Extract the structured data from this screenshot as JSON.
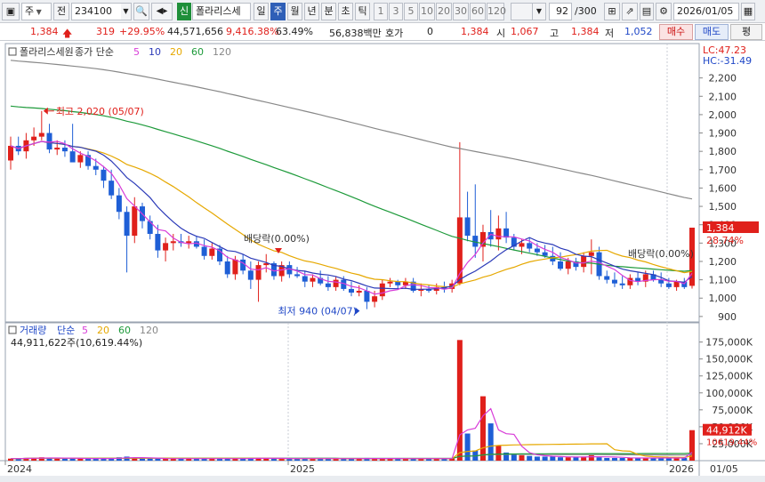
{
  "toolbar": {
    "type_select": "주",
    "prev_label": "전",
    "code": "234100",
    "tag": "신",
    "stock_name": "폴라리스세",
    "periods": [
      "일",
      "주",
      "월",
      "년",
      "분",
      "초",
      "틱"
    ],
    "period_selected": "주",
    "intervals": [
      "1",
      "3",
      "5",
      "10",
      "20",
      "30",
      "60",
      "120"
    ],
    "count": "92",
    "count_total": "/300",
    "date": "2026/01/05"
  },
  "quote": {
    "price": "1,384",
    "change": "319",
    "change_pct": "+29.95%",
    "volume": "44,571,656",
    "vol_ratio": "9,416.38%",
    "turnover": "63.49%",
    "amount": "56,838백만",
    "hoga_label": "호가",
    "hoga_value": "0",
    "ask_price": "1,384",
    "open_label": "시",
    "open": "1,067",
    "high_label": "고",
    "high": "1,384",
    "low_label": "저",
    "low": "1,052",
    "buy_label": "매수",
    "sell_label": "매도",
    "avg_label": "평"
  },
  "price_panel": {
    "legend_name": "폴라리스세원",
    "ma_label": "종가 단순",
    "ma_periods": [
      "5",
      "10",
      "20",
      "60",
      "120"
    ],
    "lc": "LC:47.23",
    "hc": "HC:-31.49",
    "y_ticks": [
      "2,200",
      "2,100",
      "2,000",
      "1,900",
      "1,800",
      "1,700",
      "1,600",
      "1,500",
      "1,400",
      "1,300",
      "1,200",
      "1,100",
      "1,000",
      "900"
    ],
    "current_tag": "1,384",
    "current_pct": "28.74%",
    "high_note": "최고 2,020 (05/07)",
    "low_note": "최저 940 (04/07)",
    "dividend_note": "배당락(0.00%)"
  },
  "volume_panel": {
    "legend_name": "거래량",
    "ma_label": "단순",
    "ma_periods": [
      "5",
      "20",
      "60",
      "120"
    ],
    "total": "44,911,622주(10,619.44%)",
    "y_ticks": [
      "175,000K",
      "150,000K",
      "125,000K",
      "100,000K",
      "75,000K",
      "50,000K",
      "25,000K"
    ],
    "current_tag": "44,912K",
    "current_pct": "10619.44%"
  },
  "x_axis": {
    "labels": [
      "2024",
      "2025",
      "2026",
      "01/05"
    ]
  },
  "colors": {
    "up": "#e0201b",
    "down": "#1f5fd6",
    "ma5": "#d83cd8",
    "ma10": "#2b3ab8",
    "ma20": "#e6a800",
    "ma60": "#1d9a3a",
    "ma120": "#888888"
  },
  "chart_data": {
    "type": "candlestick",
    "period": "weekly",
    "y_range": [
      880,
      2300
    ],
    "candles": [
      [
        1750,
        1880,
        1700,
        1830
      ],
      [
        1830,
        1880,
        1780,
        1800
      ],
      [
        1800,
        1900,
        1760,
        1860
      ],
      [
        1860,
        1930,
        1830,
        1880
      ],
      [
        1880,
        2020,
        1860,
        1900
      ],
      [
        1900,
        1950,
        1790,
        1810
      ],
      [
        1810,
        1860,
        1780,
        1820
      ],
      [
        1820,
        1860,
        1770,
        1800
      ],
      [
        1800,
        1950,
        1760,
        1740
      ],
      [
        1740,
        1800,
        1710,
        1780
      ],
      [
        1780,
        1800,
        1700,
        1720
      ],
      [
        1720,
        1760,
        1670,
        1700
      ],
      [
        1700,
        1720,
        1600,
        1640
      ],
      [
        1640,
        1700,
        1540,
        1560
      ],
      [
        1560,
        1600,
        1430,
        1470
      ],
      [
        1470,
        1500,
        1140,
        1340
      ],
      [
        1340,
        1550,
        1300,
        1500
      ],
      [
        1500,
        1520,
        1380,
        1420
      ],
      [
        1420,
        1450,
        1320,
        1350
      ],
      [
        1350,
        1400,
        1220,
        1260
      ],
      [
        1260,
        1330,
        1200,
        1300
      ],
      [
        1300,
        1350,
        1260,
        1310
      ],
      [
        1310,
        1350,
        1280,
        1300
      ],
      [
        1300,
        1340,
        1270,
        1310
      ],
      [
        1310,
        1340,
        1270,
        1280
      ],
      [
        1280,
        1320,
        1210,
        1230
      ],
      [
        1230,
        1300,
        1210,
        1270
      ],
      [
        1270,
        1290,
        1180,
        1200
      ],
      [
        1200,
        1230,
        1110,
        1130
      ],
      [
        1130,
        1230,
        1100,
        1210
      ],
      [
        1210,
        1240,
        1130,
        1150
      ],
      [
        1150,
        1200,
        1050,
        1100
      ],
      [
        1100,
        1200,
        980,
        1180
      ],
      [
        1180,
        1240,
        1140,
        1190
      ],
      [
        1190,
        1200,
        1100,
        1120
      ],
      [
        1120,
        1200,
        1090,
        1180
      ],
      [
        1180,
        1200,
        1110,
        1130
      ],
      [
        1130,
        1170,
        1110,
        1120
      ],
      [
        1120,
        1150,
        1060,
        1090
      ],
      [
        1090,
        1130,
        1060,
        1110
      ],
      [
        1110,
        1150,
        1070,
        1080
      ],
      [
        1080,
        1120,
        1040,
        1060
      ],
      [
        1060,
        1120,
        1040,
        1100
      ],
      [
        1100,
        1120,
        1040,
        1050
      ],
      [
        1050,
        1090,
        1010,
        1030
      ],
      [
        1030,
        1070,
        1010,
        1040
      ],
      [
        1040,
        1060,
        940,
        980
      ],
      [
        980,
        1040,
        950,
        1010
      ],
      [
        1010,
        1100,
        990,
        1080
      ],
      [
        1080,
        1110,
        1060,
        1090
      ],
      [
        1090,
        1100,
        1050,
        1070
      ],
      [
        1070,
        1110,
        1050,
        1090
      ],
      [
        1090,
        1110,
        1030,
        1040
      ],
      [
        1040,
        1080,
        1010,
        1050
      ],
      [
        1050,
        1070,
        1030,
        1040
      ],
      [
        1040,
        1080,
        1020,
        1060
      ],
      [
        1060,
        1090,
        1030,
        1050
      ],
      [
        1050,
        1100,
        1030,
        1080
      ],
      [
        1080,
        1850,
        1070,
        1440
      ],
      [
        1440,
        1580,
        1310,
        1340
      ],
      [
        1340,
        1620,
        1220,
        1280
      ],
      [
        1280,
        1400,
        1200,
        1360
      ],
      [
        1360,
        1480,
        1280,
        1320
      ],
      [
        1320,
        1450,
        1260,
        1380
      ],
      [
        1380,
        1470,
        1300,
        1330
      ],
      [
        1330,
        1350,
        1260,
        1280
      ],
      [
        1280,
        1320,
        1240,
        1300
      ],
      [
        1300,
        1330,
        1250,
        1270
      ],
      [
        1270,
        1300,
        1230,
        1250
      ],
      [
        1250,
        1290,
        1220,
        1230
      ],
      [
        1230,
        1280,
        1180,
        1200
      ],
      [
        1200,
        1250,
        1150,
        1160
      ],
      [
        1160,
        1220,
        1130,
        1200
      ],
      [
        1200,
        1220,
        1150,
        1170
      ],
      [
        1170,
        1250,
        1140,
        1230
      ],
      [
        1230,
        1320,
        1130,
        1250
      ],
      [
        1250,
        1280,
        1100,
        1120
      ],
      [
        1120,
        1150,
        1080,
        1100
      ],
      [
        1100,
        1140,
        1060,
        1080
      ],
      [
        1080,
        1120,
        1050,
        1070
      ],
      [
        1070,
        1130,
        1050,
        1110
      ],
      [
        1110,
        1140,
        1070,
        1090
      ],
      [
        1090,
        1150,
        1060,
        1130
      ],
      [
        1130,
        1150,
        1090,
        1100
      ],
      [
        1100,
        1140,
        1060,
        1080
      ],
      [
        1080,
        1110,
        1050,
        1060
      ],
      [
        1060,
        1100,
        1040,
        1090
      ],
      [
        1090,
        1110,
        1050,
        1060
      ],
      [
        1067,
        1384,
        1052,
        1384
      ]
    ],
    "volume": [
      3,
      3,
      4,
      4,
      5,
      4,
      3,
      3,
      4,
      3,
      3,
      3,
      3,
      4,
      5,
      6,
      4,
      3,
      3,
      3,
      3,
      3,
      3,
      3,
      3,
      3,
      3,
      3,
      3,
      3,
      3,
      4,
      4,
      3,
      3,
      3,
      3,
      3,
      3,
      3,
      3,
      3,
      3,
      3,
      3,
      3,
      4,
      3,
      3,
      3,
      3,
      3,
      3,
      3,
      3,
      3,
      3,
      3,
      178,
      40,
      15,
      95,
      55,
      22,
      12,
      10,
      8,
      7,
      6,
      6,
      6,
      5,
      5,
      5,
      6,
      8,
      5,
      4,
      4,
      4,
      4,
      4,
      4,
      4,
      4,
      4,
      4,
      4,
      45
    ]
  }
}
